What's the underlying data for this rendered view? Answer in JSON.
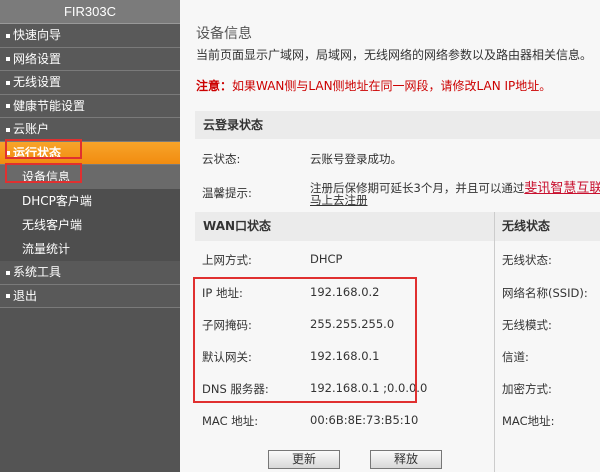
{
  "sidebar": {
    "brand": "FIR303C",
    "items": [
      "快速向导",
      "网络设置",
      "无线设置",
      "健康节能设置",
      "云账户"
    ],
    "active": "运行状态",
    "sub": [
      "设备信息",
      "DHCP客户端",
      "无线客户端",
      "流量统计"
    ],
    "items2": [
      "系统工具",
      "退出"
    ]
  },
  "main": {
    "title": "设备信息",
    "desc": "当前页面显示广域网，局域网，无线网络的网络参数以及路由器相关信息。",
    "note_label": "注意：",
    "note": "如果WAN侧与LAN侧地址在同一网段，请修改LAN IP地址。",
    "cloud": {
      "header": "云登录状态",
      "status_label": "云状态:",
      "status": "云账号登录成功。",
      "tip_label": "温馨提示:",
      "tip": "注册后保修期可延长3个月，并且可以通过",
      "tip_link": "斐讯智慧互联A",
      "register_link": "马上去注册"
    },
    "wan": {
      "header": "WAN口状态",
      "rows": [
        {
          "label": "上网方式:",
          "value": "DHCP"
        },
        {
          "label": "IP 地址:",
          "value": "192.168.0.2"
        },
        {
          "label": "子网掩码:",
          "value": "255.255.255.0"
        },
        {
          "label": "默认网关:",
          "value": "192.168.0.1"
        },
        {
          "label": "DNS 服务器:",
          "value": "192.168.0.1 ;0.0.0.0"
        },
        {
          "label": "MAC 地址:",
          "value": "00:6B:8E:73:B5:10"
        }
      ],
      "renew": "更新",
      "release": "释放"
    },
    "wireless": {
      "header": "无线状态",
      "rows": [
        "无线状态:",
        "网络名称(SSID):",
        "无线模式:",
        "信道:",
        "加密方式:",
        "MAC地址:"
      ]
    }
  }
}
